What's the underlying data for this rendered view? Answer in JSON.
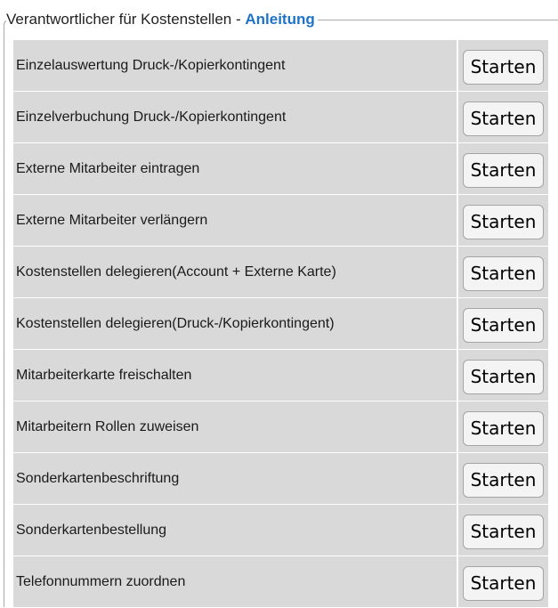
{
  "section": {
    "legend_text": "Verantwortlicher für Kostenstellen - ",
    "guide_link": "Anleitung"
  },
  "rows": [
    {
      "label": "Einzelauswertung Druck-/Kopierkontingent",
      "button": "Starten"
    },
    {
      "label": "Einzelverbuchung Druck-/Kopierkontingent",
      "button": "Starten"
    },
    {
      "label": "Externe Mitarbeiter eintragen",
      "button": "Starten"
    },
    {
      "label": "Externe Mitarbeiter verlängern",
      "button": "Starten"
    },
    {
      "label": "Kostenstellen delegieren(Account + Externe Karte)",
      "button": "Starten"
    },
    {
      "label": "Kostenstellen delegieren(Druck-/Kopierkontingent)",
      "button": "Starten"
    },
    {
      "label": "Mitarbeiterkarte freischalten",
      "button": "Starten"
    },
    {
      "label": "Mitarbeitern Rollen zuweisen",
      "button": "Starten"
    },
    {
      "label": "Sonderkartenbeschriftung",
      "button": "Starten"
    },
    {
      "label": "Sonderkartenbestellung",
      "button": "Starten"
    },
    {
      "label": "Telefonnummern zuordnen",
      "button": "Starten"
    }
  ],
  "colors": {
    "row_background": "#d9d9d9",
    "link": "#1e73c8",
    "button_background": "#f4f4f4"
  }
}
